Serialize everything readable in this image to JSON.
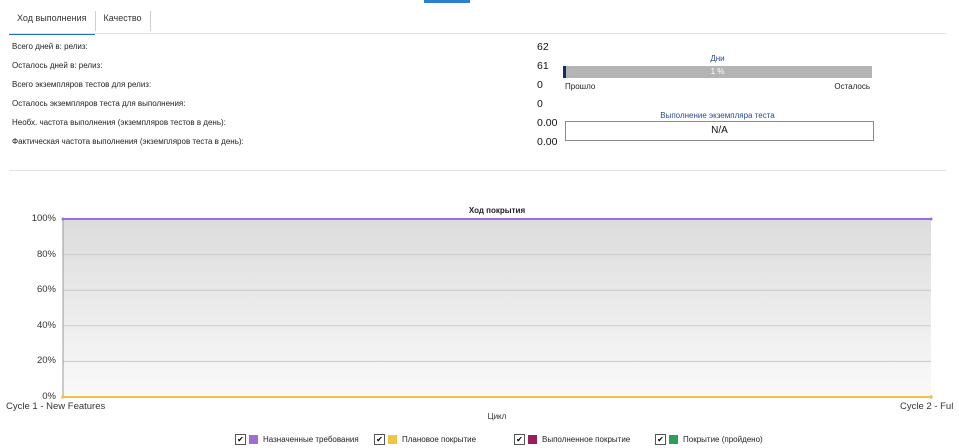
{
  "tabs": [
    {
      "label": "Ход выполнения",
      "active": true
    },
    {
      "label": "Качество",
      "active": false
    }
  ],
  "stats": [
    {
      "label": "Всего дней в: релиз:",
      "value": "62"
    },
    {
      "label": "Осталось дней в: релиз:",
      "value": "61"
    },
    {
      "label": "Всего экземпляров тестов для релиз:",
      "value": "0"
    },
    {
      "label": "Осталось экземпляров теста для выполнения:",
      "value": "0"
    },
    {
      "label": "Необх. частота выполнения (экземпляров тестов в день):",
      "value": "0.00"
    },
    {
      "label": "Фактическая частота выполнения (экземпляров теста в день):",
      "value": "0.00"
    }
  ],
  "days_widget": {
    "title": "Дни",
    "percent_label": "1 %",
    "progress_fraction": 0.01,
    "left_label": "Прошло",
    "right_label": "Осталось",
    "fill_color": "#14286e",
    "bar_color": "#b4b4b4"
  },
  "execution_widget": {
    "title": "Выполнение экземпляра теста",
    "value": "N/A"
  },
  "chart_data": {
    "type": "area",
    "title": "Ход покрытия",
    "xlabel": "Цикл",
    "ylabel": "",
    "categories": [
      "Cycle 1 - New Features",
      "Cycle 2 - Ful"
    ],
    "y_ticks": [
      "0%",
      "20%",
      "40%",
      "60%",
      "80%",
      "100%"
    ],
    "ylim": [
      0,
      100
    ],
    "grid": true,
    "legend_position": "bottom",
    "series": [
      {
        "name": "Назначенные требования",
        "values": [
          100,
          100
        ],
        "color": "#9b6fd6",
        "checked": true
      },
      {
        "name": "Плановое покрытие",
        "values": [
          0,
          0
        ],
        "color": "#f2c443",
        "checked": true
      },
      {
        "name": "Выполненное покрытие",
        "values": [
          0,
          0
        ],
        "color": "#9c1f5c",
        "checked": true
      },
      {
        "name": "Покрытие (пройдено)",
        "values": [
          0,
          0
        ],
        "color": "#2e9e5b",
        "checked": true
      }
    ],
    "checkbox_glyph": "✔"
  }
}
